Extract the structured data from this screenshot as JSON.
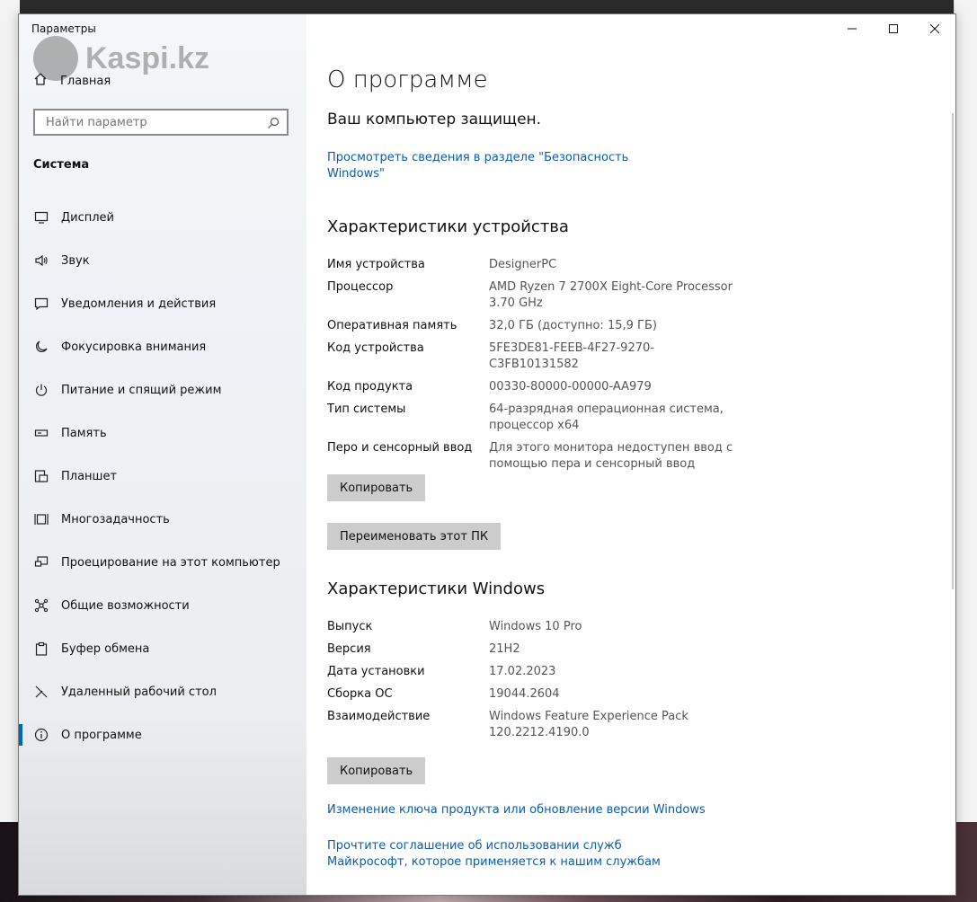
{
  "window": {
    "title": "Параметры",
    "watermark_text": "Kaspi.kz"
  },
  "sidebar": {
    "home_label": "Главная",
    "search_placeholder": "Найти параметр",
    "section": "Система",
    "items": [
      {
        "label": "Дисплей",
        "icon": "monitor-icon"
      },
      {
        "label": "Звук",
        "icon": "speaker-icon"
      },
      {
        "label": "Уведомления и действия",
        "icon": "notification-icon"
      },
      {
        "label": "Фокусировка внимания",
        "icon": "moon-icon"
      },
      {
        "label": "Питание и спящий режим",
        "icon": "power-icon"
      },
      {
        "label": "Память",
        "icon": "storage-icon"
      },
      {
        "label": "Планшет",
        "icon": "tablet-icon"
      },
      {
        "label": "Многозадачность",
        "icon": "multitask-icon"
      },
      {
        "label": "Проецирование на этот компьютер",
        "icon": "project-icon"
      },
      {
        "label": "Общие возможности",
        "icon": "shared-icon"
      },
      {
        "label": "Буфер обмена",
        "icon": "clipboard-icon"
      },
      {
        "label": "Удаленный рабочий стол",
        "icon": "remote-icon"
      },
      {
        "label": "О программе",
        "icon": "info-icon",
        "active": true
      }
    ]
  },
  "main": {
    "title": "О программе",
    "protected": "Ваш компьютер защищен.",
    "security_link": "Просмотреть сведения в разделе \"Безопасность Windows\"",
    "device_heading": "Характеристики устройства",
    "device_specs": [
      {
        "key": "Имя устройства",
        "value": "DesignerPC"
      },
      {
        "key": "Процессор",
        "value": "AMD Ryzen 7 2700X Eight-Core Processor 3.70 GHz"
      },
      {
        "key": "Оперативная память",
        "value": "32,0 ГБ (доступно: 15,9 ГБ)"
      },
      {
        "key": "Код устройства",
        "value": "5FE3DE81-FEEB-4F27-9270-C3FB10131582"
      },
      {
        "key": "Код продукта",
        "value": "00330-80000-00000-AA979"
      },
      {
        "key": "Тип системы",
        "value": "64-разрядная операционная система, процессор x64"
      },
      {
        "key": "Перо и сенсорный ввод",
        "value": "Для этого монитора недоступен ввод с помощью пера и сенсорный ввод"
      }
    ],
    "copy_button": "Копировать",
    "rename_button": "Переименовать этот ПК",
    "windows_heading": "Характеристики Windows",
    "windows_specs": [
      {
        "key": "Выпуск",
        "value": "Windows 10 Pro"
      },
      {
        "key": "Версия",
        "value": "21H2"
      },
      {
        "key": "Дата установки",
        "value": "17.02.2023"
      },
      {
        "key": "Сборка ОС",
        "value": "19044.2604"
      },
      {
        "key": "Взаимодействие",
        "value": "Windows Feature Experience Pack 120.2212.4190.0"
      }
    ],
    "copy_button2": "Копировать",
    "link_product_key": "Изменение ключа продукта или обновление версии Windows",
    "link_agreement": "Прочтите соглашение об использовании служб Майкрософт, которое применяется к нашим службам"
  }
}
